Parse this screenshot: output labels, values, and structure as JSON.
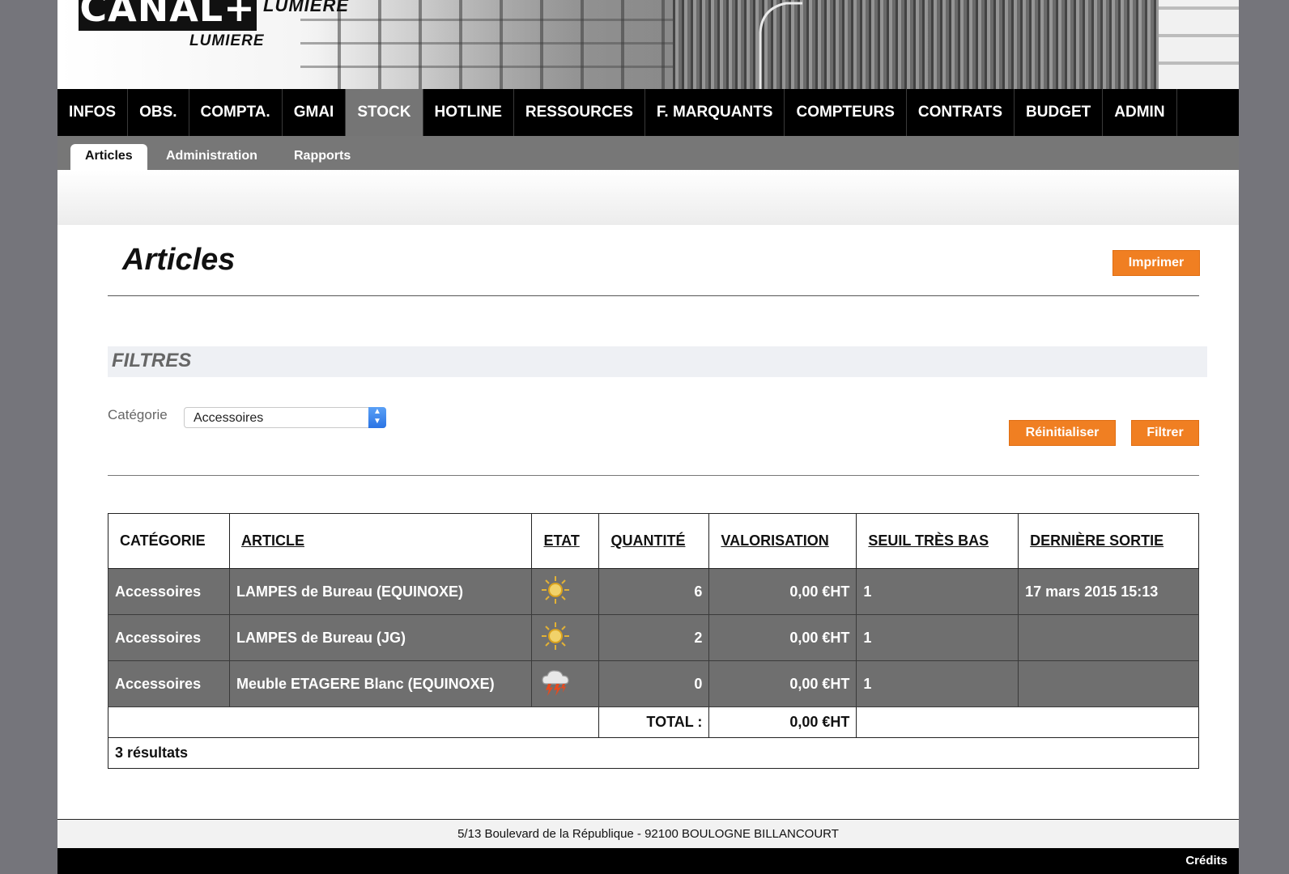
{
  "brand": {
    "logo_main": "CANAL+",
    "logo_sub": "LUMIERE",
    "logo_side": "LUMIERE"
  },
  "main_nav": [
    "INFOS",
    "OBS.",
    "COMPTA.",
    "GMAI",
    "STOCK",
    "HOTLINE",
    "RESSOURCES",
    "F. MARQUANTS",
    "COMPTEURS",
    "CONTRATS",
    "BUDGET",
    "ADMIN"
  ],
  "main_nav_active": "STOCK",
  "sub_nav": {
    "articles": "Articles",
    "administration": "Administration",
    "rapports": "Rapports"
  },
  "page": {
    "title": "Articles",
    "print_button": "Imprimer"
  },
  "filters": {
    "heading": "FILTRES",
    "category_label": "Catégorie",
    "category_value": "Accessoires",
    "reset_button": "Réinitialiser",
    "filter_button": "Filtrer"
  },
  "table": {
    "headers": {
      "categorie": "CATÉGORIE",
      "article": "ARTICLE",
      "etat": "ETAT",
      "quantite": "QUANTITÉ",
      "valorisation": "VALORISATION",
      "seuil": "SEUIL TRÈS BAS",
      "derniere": "DERNIÈRE SORTIE"
    },
    "rows": [
      {
        "categorie": "Accessoires",
        "article": "LAMPES de Bureau (EQUINOXE)",
        "etat_icon": "sun-icon",
        "quantite": "6",
        "valorisation": "0,00 €HT",
        "seuil": "1",
        "derniere": "17 mars 2015 15:13"
      },
      {
        "categorie": "Accessoires",
        "article": "LAMPES de Bureau (JG)",
        "etat_icon": "sun-icon",
        "quantite": "2",
        "valorisation": "0,00 €HT",
        "seuil": "1",
        "derniere": ""
      },
      {
        "categorie": "Accessoires",
        "article": "Meuble ETAGERE Blanc (EQUINOXE)",
        "etat_icon": "storm-icon",
        "quantite": "0",
        "valorisation": "0,00 €HT",
        "seuil": "1",
        "derniere": ""
      }
    ],
    "total_label": "TOTAL :",
    "total_value": "0,00 €HT",
    "results": "3 résultats"
  },
  "footer": {
    "address": "5/13 Boulevard de la République - 92100 BOULOGNE BILLANCOURT",
    "credits": "Crédits"
  },
  "colors": {
    "accent": "#f07f22",
    "nav_bg": "#000000",
    "active_tab": "#757575",
    "row_bg": "#6f6f6f"
  }
}
